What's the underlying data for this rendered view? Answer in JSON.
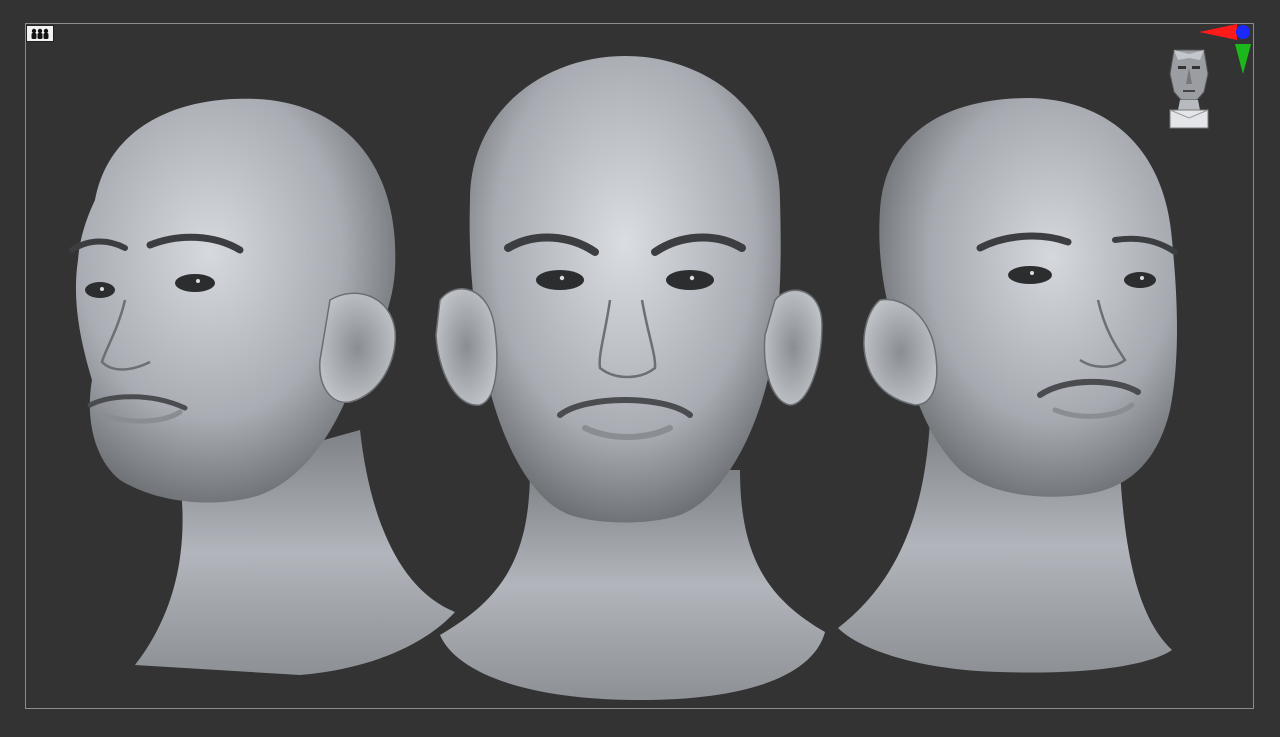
{
  "viewport": {
    "background": "#333333",
    "frame_color": "#8c8c8c"
  },
  "toolbar": {
    "floor_button_icon": "three-figures-icon"
  },
  "navigation": {
    "gizmo_icon": "axis-gizmo-icon",
    "gizmo_colors": {
      "x": "#ff1a1a",
      "y": "#1ab81a",
      "z": "#1a2aff"
    },
    "head_icon": "navigation-head-icon"
  },
  "scene": {
    "views": [
      "left-three-quarter-head",
      "front-head",
      "right-three-quarter-head"
    ]
  }
}
